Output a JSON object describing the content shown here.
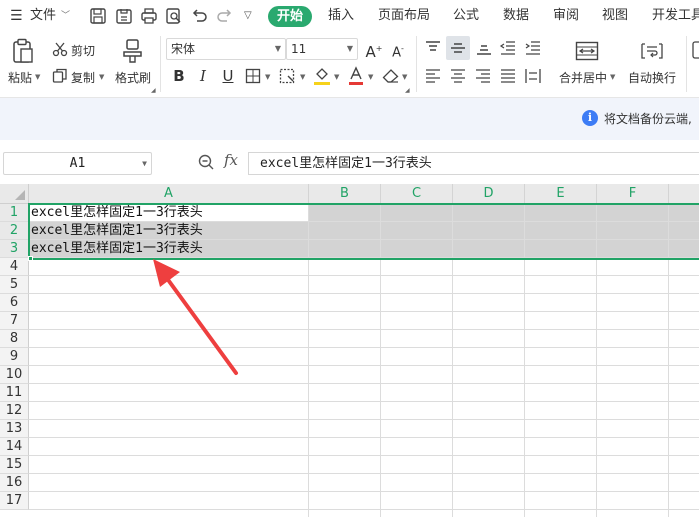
{
  "menu": {
    "file": "文件",
    "tabs": [
      "开始",
      "插入",
      "页面布局",
      "公式",
      "数据",
      "审阅",
      "视图",
      "开发工具"
    ]
  },
  "ribbon": {
    "paste": "粘贴",
    "cut": "剪切",
    "copy": "复制",
    "format_painter": "格式刷",
    "font_name": "宋体",
    "font_size": "11",
    "merge_center": "合并居中",
    "wrap_text": "自动换行"
  },
  "info": {
    "text": "将文档备份云端,",
    "icon": "i"
  },
  "formula_bar": {
    "name_box": "A1",
    "fx": "fx",
    "content": "excel里怎样固定1一3行表头"
  },
  "grid": {
    "columns": [
      "A",
      "B",
      "C",
      "D",
      "E",
      "F"
    ],
    "rows": [
      "1",
      "2",
      "3",
      "4",
      "5",
      "6",
      "7",
      "8",
      "9",
      "10",
      "11",
      "12",
      "13",
      "14",
      "15",
      "16",
      "17"
    ],
    "cells": {
      "A1": "excel里怎样固定1一3行表头",
      "A2": "excel里怎样固定1一3行表头",
      "A3": "excel里怎样固定1一3行表头"
    }
  },
  "colors": {
    "accent_green": "#21a366",
    "tab_active": "#2aa96f",
    "arrow": "#ee3f3f",
    "info_bg": "#f1f4fb"
  }
}
